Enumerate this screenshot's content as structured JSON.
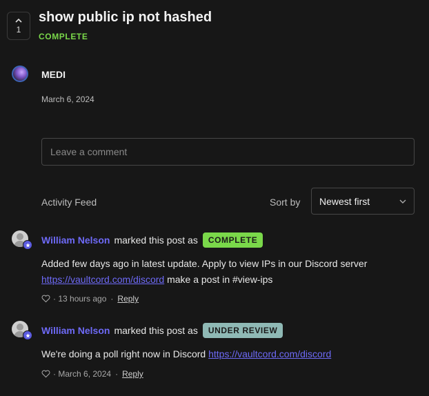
{
  "post": {
    "votes": "1",
    "title": "show public ip not hashed",
    "status": "COMPLETE",
    "status_color": "#7ad84a",
    "author": "MEDI",
    "date": "March 6, 2024"
  },
  "comment_input": {
    "placeholder": "Leave a comment"
  },
  "feed": {
    "label": "Activity Feed",
    "sort_label": "Sort by",
    "sort_value": "Newest first"
  },
  "activities": [
    {
      "user": "William Nelson",
      "action": "marked this post as",
      "badge": "COMPLETE",
      "badge_color": "#7ad84a",
      "text": "Added few days ago in latest update. Apply to view IPs in our Discord server",
      "link": "https://vaultcord.com/discord",
      "text_after": "make a post in #view-ips",
      "time": "13 hours ago",
      "reply": "Reply"
    },
    {
      "user": "William Nelson",
      "action": "marked this post as",
      "badge": "UNDER REVIEW",
      "badge_color": "#8fb9b5",
      "text": "We're doing a poll right now in Discord",
      "link": "https://vaultcord.com/discord",
      "text_after": "",
      "time": "March 6, 2024",
      "reply": "Reply"
    }
  ],
  "icons": {
    "upvote": "chevron-up-icon",
    "sort": "chevron-down-icon",
    "like": "heart-icon",
    "admin": "star-icon"
  }
}
